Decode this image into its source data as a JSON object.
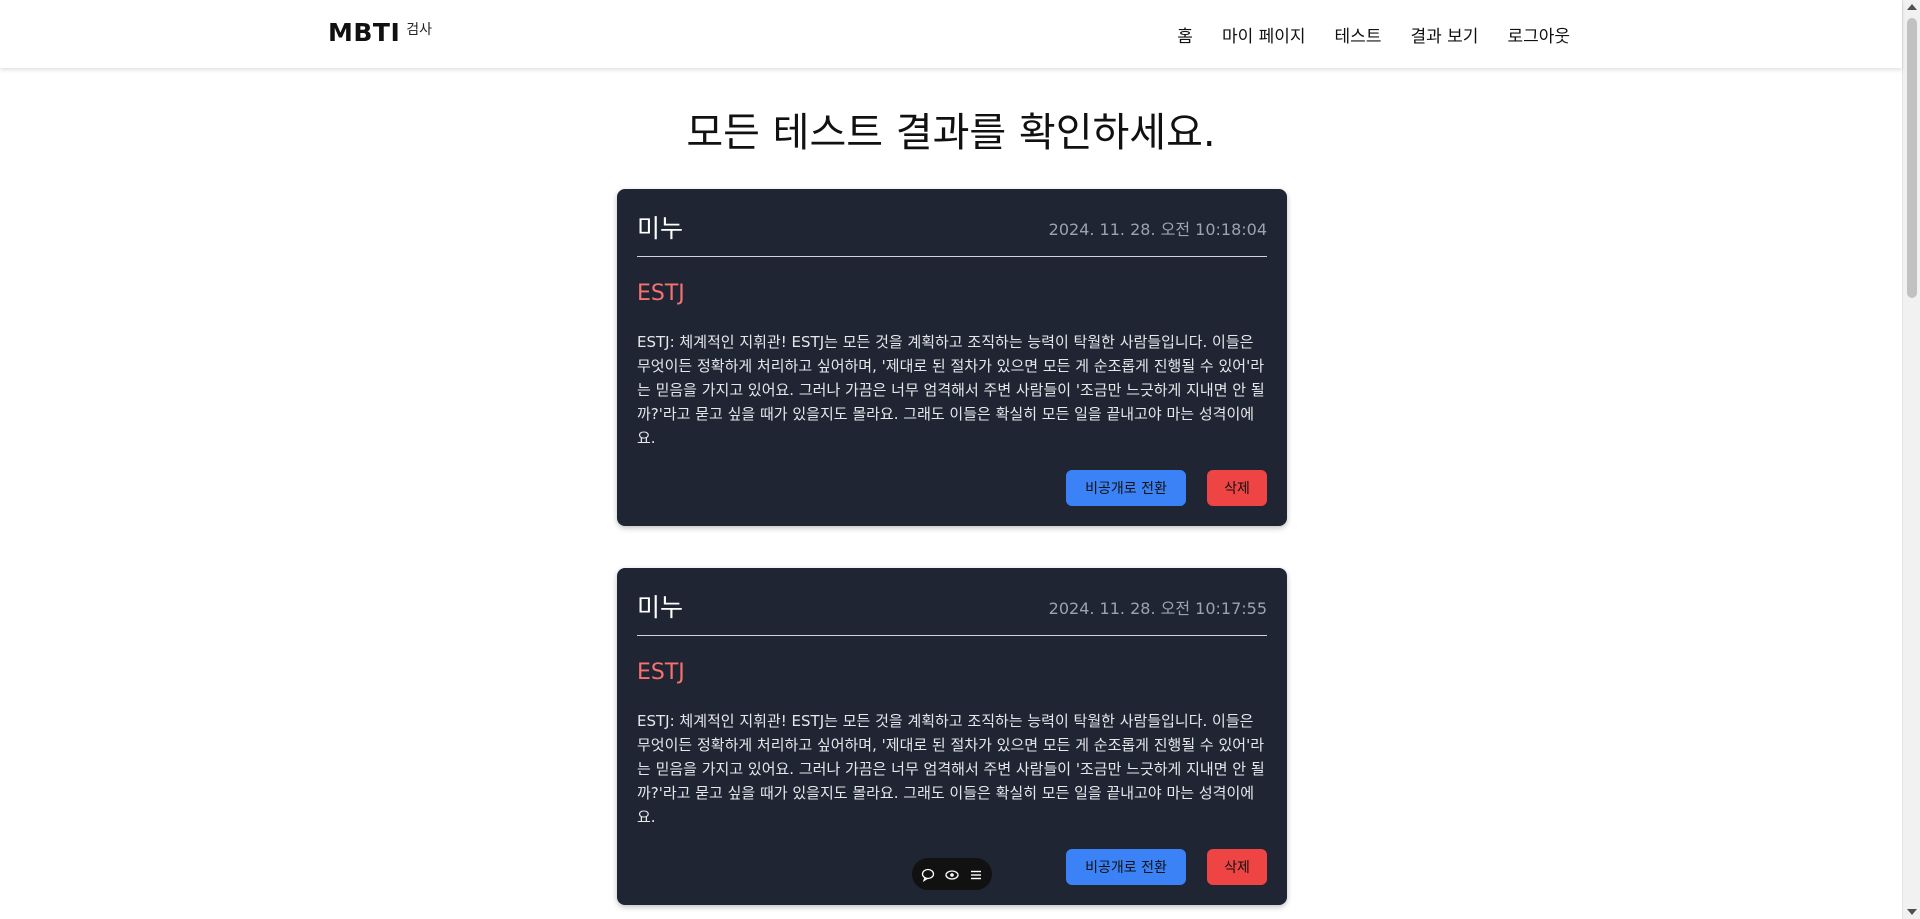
{
  "header": {
    "brand": "MBTI",
    "brand_sub": "검사",
    "nav": [
      "홈",
      "마이 페이지",
      "테스트",
      "결과 보기",
      "로그아웃"
    ]
  },
  "page": {
    "title": "모든 테스트 결과를 확인하세요."
  },
  "results": [
    {
      "user": "미누",
      "date": "2024. 11. 28. 오전 10:18:04",
      "mbti": "ESTJ",
      "description": "ESTJ: 체계적인 지휘관! ESTJ는 모든 것을 계획하고 조직하는 능력이 탁월한 사람들입니다. 이들은 무엇이든 정확하게 처리하고 싶어하며, '제대로 된 절차가 있으면 모든 게 순조롭게 진행될 수 있어'라는 믿음을 가지고 있어요. 그러나 가끔은 너무 엄격해서 주변 사람들이 '조금만 느긋하게 지내면 안 될까?'라고 묻고 싶을 때가 있을지도 몰라요. 그래도 이들은 확실히 모든 일을 끝내고야 마는 성격이에요.",
      "private_button": "비공개로 전환",
      "delete_button": "삭제"
    },
    {
      "user": "미누",
      "date": "2024. 11. 28. 오전 10:17:55",
      "mbti": "ESTJ",
      "description": "ESTJ: 체계적인 지휘관! ESTJ는 모든 것을 계획하고 조직하는 능력이 탁월한 사람들입니다. 이들은 무엇이든 정확하게 처리하고 싶어하며, '제대로 된 절차가 있으면 모든 게 순조롭게 진행될 수 있어'라는 믿음을 가지고 있어요. 그러나 가끔은 너무 엄격해서 주변 사람들이 '조금만 느긋하게 지내면 안 될까?'라고 묻고 싶을 때가 있을지도 몰라요. 그래도 이들은 확실히 모든 일을 끝내고야 마는 성격이에요.",
      "private_button": "비공개로 전환",
      "delete_button": "삭제"
    }
  ],
  "toolbar": {
    "icons": [
      "comment-icon",
      "eye-icon",
      "menu-icon"
    ]
  },
  "colors": {
    "card_bg": "#1f2533",
    "mbti_accent": "#f87171",
    "private_button": "#3b82f6",
    "delete_button": "#ef4444"
  }
}
